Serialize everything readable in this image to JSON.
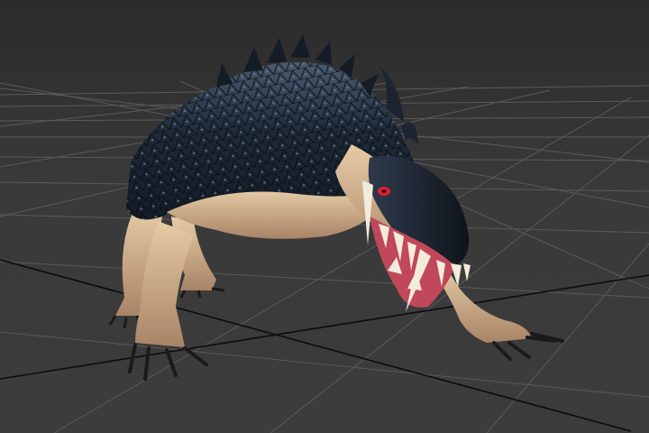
{
  "viewport": {
    "background_color": "#3a3a3a",
    "grid_color": "#5a5a5a",
    "axis_color": "#0c0c0c",
    "grid_visible": true,
    "view": "perspective"
  },
  "model": {
    "subject": "creature-model",
    "colors": {
      "scales": "#1e2a38",
      "scales_highlight": "#4a5a70",
      "skin": "#d8b892",
      "skin_shadow": "#8a6a52",
      "mouth": "#c0485a",
      "teeth": "#f2ecdc",
      "eye": "#e02030",
      "claws": "#1a1a1a"
    }
  }
}
